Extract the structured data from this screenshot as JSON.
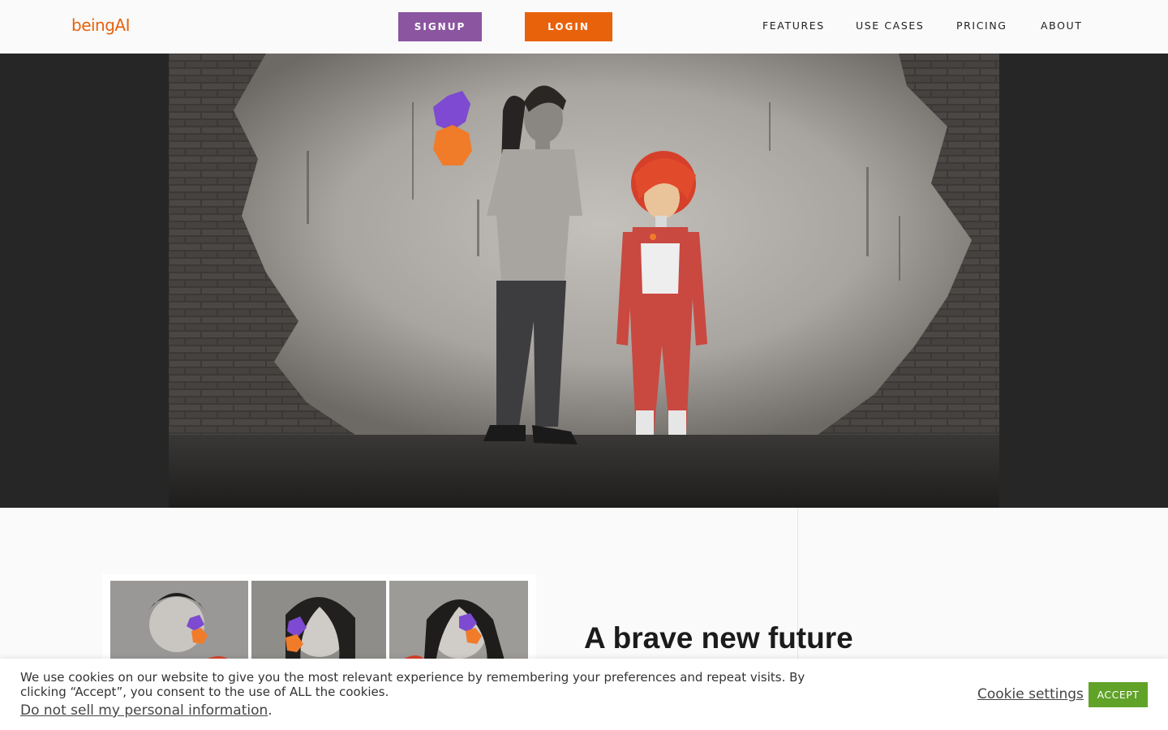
{
  "header": {
    "logo_text": "beingAI",
    "signup_label": "SIGNUP",
    "login_label": "LOGIN",
    "nav": [
      "FEATURES",
      "USE CASES",
      "PRICING",
      "ABOUT"
    ]
  },
  "main": {
    "headline": "A brave new future"
  },
  "cookie": {
    "message": "We use cookies on our website to give you the most relevant experience by remembering your preferences and repeat visits. By clicking “Accept”, you consent to the use of ALL the cookies.",
    "do_not_sell": "Do not sell my personal information",
    "do_not_sell_suffix": ".",
    "settings_label": "Cookie settings",
    "accept_label": "ACCEPT"
  },
  "colors": {
    "brand_orange": "#e8620c",
    "brand_purple": "#8b559f",
    "accept_green": "#61a229",
    "hero_bg": "#262626"
  }
}
